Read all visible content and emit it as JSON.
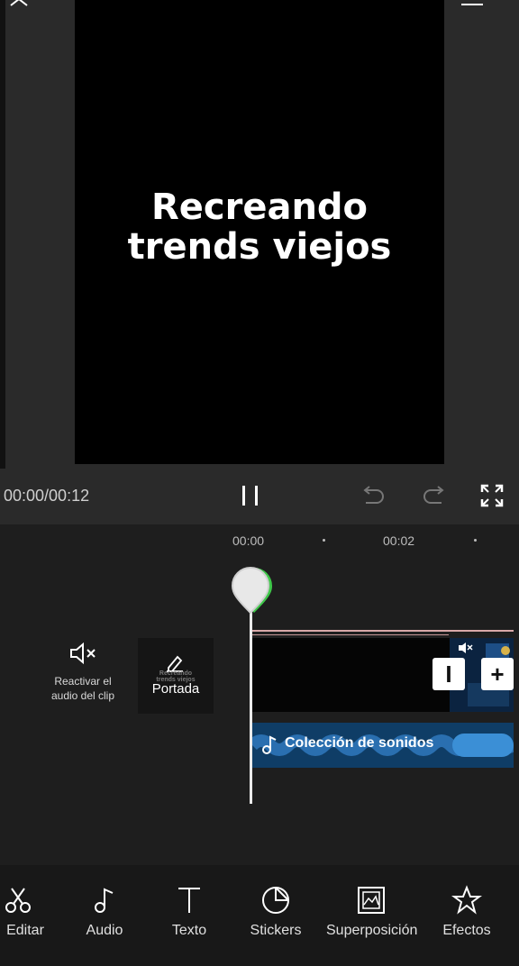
{
  "preview": {
    "title_line1": "Recreando",
    "title_line2": "trends viejos"
  },
  "player": {
    "timecode": "00:00/00:12"
  },
  "ruler": {
    "mark1": "00:00",
    "mark2": "00:02"
  },
  "mute_tool": {
    "label_line1": "Reactivar el",
    "label_line2": "audio del clip"
  },
  "cover": {
    "mini_line1": "Recreando",
    "mini_line2": "trends viejos",
    "label": "Portada"
  },
  "audio_track": {
    "label": "Colección de sonidos"
  },
  "toolbar": {
    "items": [
      {
        "label": "Editar",
        "icon": "scissors-icon"
      },
      {
        "label": "Audio",
        "icon": "music-note-icon"
      },
      {
        "label": "Texto",
        "icon": "text-icon"
      },
      {
        "label": "Stickers",
        "icon": "sticker-icon"
      },
      {
        "label": "Superposición",
        "icon": "overlay-icon"
      },
      {
        "label": "Efectos",
        "icon": "effects-star-icon"
      }
    ]
  },
  "colors": {
    "background": "#222222",
    "timeline": "#1e1e1e",
    "audio": "#0f3d66",
    "playhead": "#eaeaea"
  }
}
